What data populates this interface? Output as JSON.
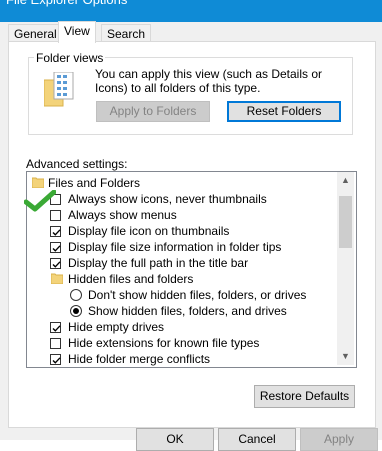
{
  "window": {
    "title": "File Explorer Options",
    "accent_color": "#0f8bd6"
  },
  "tabs": [
    {
      "label": "General"
    },
    {
      "label": "View"
    },
    {
      "label": "Search"
    }
  ],
  "folder_views": {
    "legend": "Folder views",
    "icon": "folder-views-icon",
    "description": "You can apply this view (such as Details or Icons) to all folders of this type.",
    "apply_button": "Apply to Folders",
    "reset_button": "Reset Folders"
  },
  "advanced": {
    "label": "Advanced settings:",
    "tree": [
      {
        "type": "folder",
        "label": "Files and Folders"
      },
      {
        "type": "checkbox",
        "label": "Always show icons, never thumbnails",
        "checked": true
      },
      {
        "type": "checkbox",
        "label": "Always show menus",
        "checked": false
      },
      {
        "type": "checkbox",
        "label": "Display file icon on thumbnails",
        "checked": true
      },
      {
        "type": "checkbox",
        "label": "Display file size information in folder tips",
        "checked": true
      },
      {
        "type": "checkbox",
        "label": "Display the full path in the title bar",
        "checked": true
      },
      {
        "type": "folder",
        "label": "Hidden files and folders"
      },
      {
        "type": "radio",
        "label": "Don't show hidden files, folders, or drives",
        "selected": false
      },
      {
        "type": "radio",
        "label": "Show hidden files, folders, and drives",
        "selected": true
      },
      {
        "type": "checkbox",
        "label": "Hide empty drives",
        "checked": true
      },
      {
        "type": "checkbox",
        "label": "Hide extensions for known file types",
        "checked": false
      },
      {
        "type": "checkbox",
        "label": "Hide folder merge conflicts",
        "checked": true
      }
    ],
    "restore_button": "Restore Defaults"
  },
  "annotation": {
    "icon": "green-checkmark-icon",
    "color": "#3aa935"
  },
  "dialog_buttons": {
    "ok": "OK",
    "cancel": "Cancel",
    "apply": "Apply"
  }
}
